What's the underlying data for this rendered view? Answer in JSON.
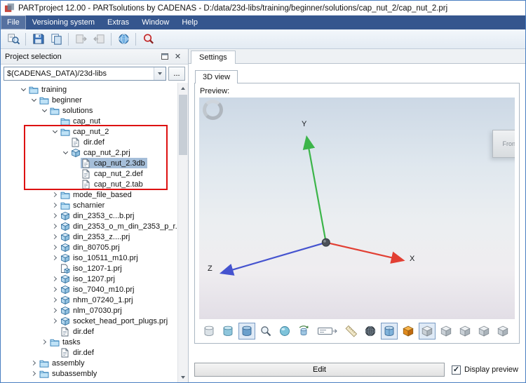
{
  "window": {
    "title": "PARTproject 12.00 - PARTsolutions by CADENAS - D:/data/23d-libs/training/beginner/solutions/cap_nut_2/cap_nut_2.prj"
  },
  "menu": {
    "items": [
      "File",
      "Versioning system",
      "Extras",
      "Window",
      "Help"
    ]
  },
  "toolbar": {
    "buttons": [
      {
        "name": "search-project-icon",
        "sep_before": false,
        "disabled": false
      },
      {
        "name": "save-icon",
        "sep_before": true,
        "disabled": false
      },
      {
        "name": "copy-project-icon",
        "sep_before": false,
        "disabled": false
      },
      {
        "name": "export-icon",
        "sep_before": true,
        "disabled": true
      },
      {
        "name": "import-icon",
        "sep_before": false,
        "disabled": true
      },
      {
        "name": "online-catalog-icon",
        "sep_before": true,
        "disabled": false
      },
      {
        "name": "search-icon",
        "sep_before": true,
        "disabled": false
      }
    ]
  },
  "project_panel": {
    "title": "Project selection",
    "path_value": "$(CADENAS_DATA)/23d-libs",
    "browse_label": "...",
    "tree": [
      {
        "label": "training",
        "level": 0,
        "arrow": "expanded",
        "icon": "folder"
      },
      {
        "label": "beginner",
        "level": 1,
        "arrow": "expanded",
        "icon": "folder"
      },
      {
        "label": "solutions",
        "level": 2,
        "arrow": "expanded",
        "icon": "folder"
      },
      {
        "label": "cap_nut",
        "level": 3,
        "arrow": "none",
        "icon": "folder"
      },
      {
        "label": "cap_nut_2",
        "level": 3,
        "arrow": "expanded",
        "icon": "folder",
        "annotated": true
      },
      {
        "label": "dir.def",
        "level": 4,
        "arrow": "none",
        "icon": "doc",
        "annotated": true
      },
      {
        "label": "cap_nut_2.prj",
        "level": 4,
        "arrow": "expanded",
        "icon": "cube",
        "annotated": true
      },
      {
        "label": "cap_nut_2.3db",
        "level": 5,
        "arrow": "none",
        "icon": "doc",
        "selected": true,
        "annotated": true
      },
      {
        "label": "cap_nut_2.def",
        "level": 5,
        "arrow": "none",
        "icon": "doc",
        "annotated": true
      },
      {
        "label": "cap_nut_2.tab",
        "level": 5,
        "arrow": "none",
        "icon": "doc",
        "annotated": true
      },
      {
        "label": "mode_file_based",
        "level": 3,
        "arrow": "collapsed",
        "icon": "folder"
      },
      {
        "label": "scharnier",
        "level": 3,
        "arrow": "collapsed",
        "icon": "folder"
      },
      {
        "label": "din_2353_c...b.prj",
        "level": 3,
        "arrow": "collapsed",
        "icon": "cube"
      },
      {
        "label": "din_2353_o_m_din_2353_p_r...",
        "level": 3,
        "arrow": "collapsed",
        "icon": "cube"
      },
      {
        "label": "din_2353_z....prj",
        "level": 3,
        "arrow": "collapsed",
        "icon": "cube"
      },
      {
        "label": "din_80705.prj",
        "level": 3,
        "arrow": "collapsed",
        "icon": "cube"
      },
      {
        "label": "iso_10511_m10.prj",
        "level": 3,
        "arrow": "collapsed",
        "icon": "cube"
      },
      {
        "label": "iso_1207-1.prj",
        "level": 3,
        "arrow": "none",
        "icon": "doc-cube"
      },
      {
        "label": "iso_1207.prj",
        "level": 3,
        "arrow": "collapsed",
        "icon": "cube"
      },
      {
        "label": "iso_7040_m10.prj",
        "level": 3,
        "arrow": "collapsed",
        "icon": "cube"
      },
      {
        "label": "nhm_07240_1.prj",
        "level": 3,
        "arrow": "collapsed",
        "icon": "cube"
      },
      {
        "label": "nlm_07030.prj",
        "level": 3,
        "arrow": "collapsed",
        "icon": "cube"
      },
      {
        "label": "socket_head_port_plugs.prj",
        "level": 3,
        "arrow": "collapsed",
        "icon": "cube"
      },
      {
        "label": "dir.def",
        "level": 3,
        "arrow": "none",
        "icon": "doc"
      },
      {
        "label": "tasks",
        "level": 2,
        "arrow": "collapsed",
        "icon": "folder"
      },
      {
        "label": "dir.def",
        "level": 3,
        "arrow": "none",
        "icon": "doc"
      },
      {
        "label": "assembly",
        "level": 1,
        "arrow": "collapsed",
        "icon": "folder"
      },
      {
        "label": "subassembly",
        "level": 1,
        "arrow": "collapsed",
        "icon": "folder"
      }
    ]
  },
  "settings_panel": {
    "tab_label": "Settings",
    "view_tab_label": "3D view",
    "preview_label": "Preview:",
    "axes": {
      "x": "X",
      "y": "Y",
      "z": "Z"
    },
    "viewcube_label": "Front",
    "viewport_toolbar": [
      {
        "name": "cylinder-flat-icon",
        "toggled": false,
        "wide": false
      },
      {
        "name": "cylinder-shaded-icon",
        "toggled": false,
        "wide": false
      },
      {
        "name": "cylinder-solid-icon",
        "toggled": true,
        "wide": false
      },
      {
        "name": "zoom-icon",
        "toggled": false,
        "wide": false
      },
      {
        "name": "rotate-sphere-icon",
        "toggled": false,
        "wide": false
      },
      {
        "name": "turntable-icon",
        "toggled": false,
        "wide": false
      },
      {
        "name": "dimension-label-icon",
        "toggled": false,
        "wide": true
      },
      {
        "name": "ruler-icon",
        "toggled": false,
        "wide": false
      },
      {
        "name": "wireframe-sphere-icon",
        "toggled": false,
        "wide": false
      },
      {
        "name": "cylinder-preview-icon",
        "toggled": true,
        "wide": false
      },
      {
        "name": "orange-cube-icon",
        "toggled": false,
        "wide": false
      },
      {
        "name": "iso-cube-icon",
        "toggled": true,
        "wide": false
      },
      {
        "name": "cube-view-2-icon",
        "toggled": false,
        "wide": false
      },
      {
        "name": "cube-view-3-icon",
        "toggled": false,
        "wide": false
      },
      {
        "name": "cube-view-4-icon",
        "toggled": false,
        "wide": false
      },
      {
        "name": "cube-view-5-icon",
        "toggled": false,
        "wide": false
      }
    ],
    "edit_button": "Edit",
    "display_preview": {
      "label": "Display preview",
      "checked": true
    }
  },
  "colors": {
    "axis_x": "#e23f33",
    "axis_y": "#3cb54a",
    "axis_z": "#4553cf",
    "annotation": "#dd1111",
    "selection": "#a5bed9",
    "menu_bar": "#35568e"
  }
}
